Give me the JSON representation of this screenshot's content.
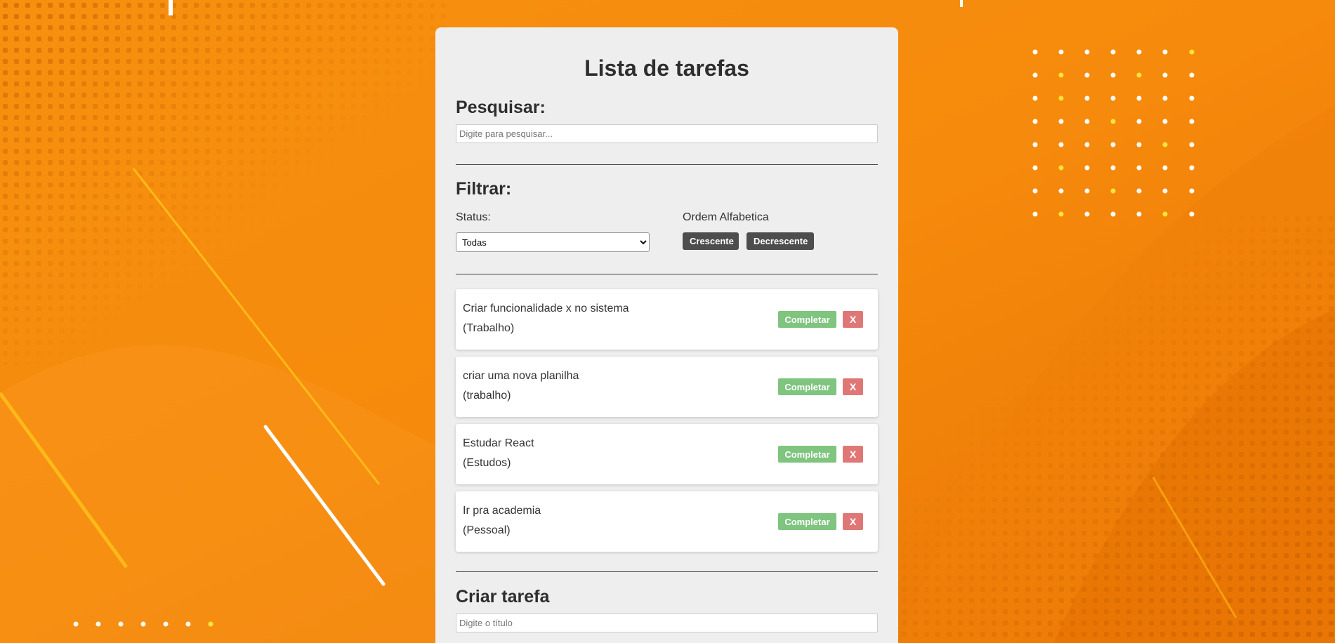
{
  "app": {
    "title": "Lista de tarefas"
  },
  "search": {
    "heading": "Pesquisar:",
    "placeholder": "Digite para pesquisar..."
  },
  "filter": {
    "heading": "Filtrar:",
    "status_label": "Status:",
    "status_selected": "Todas",
    "order_label": "Ordem Alfabetica",
    "asc_label": "Crescente",
    "desc_label": "Decrescente"
  },
  "todos": [
    {
      "text": "Criar funcionalidade x no sistema",
      "category": "(Trabalho)",
      "complete_label": "Completar",
      "remove_label": "X"
    },
    {
      "text": "criar uma nova planilha",
      "category": "(trabalho)",
      "complete_label": "Completar",
      "remove_label": "X"
    },
    {
      "text": "Estudar React",
      "category": "(Estudos)",
      "complete_label": "Completar",
      "remove_label": "X"
    },
    {
      "text": "Ir pra academia",
      "category": "(Pessoal)",
      "complete_label": "Completar",
      "remove_label": "X"
    }
  ],
  "create": {
    "heading": "Criar tarefa",
    "title_placeholder": "Digite o título"
  },
  "colors": {
    "background_orange": "#f6870f",
    "panel": "#eeeeee",
    "complete_button": "#7fc47f",
    "remove_button": "#e07777",
    "sort_button": "#4d4d4d"
  }
}
